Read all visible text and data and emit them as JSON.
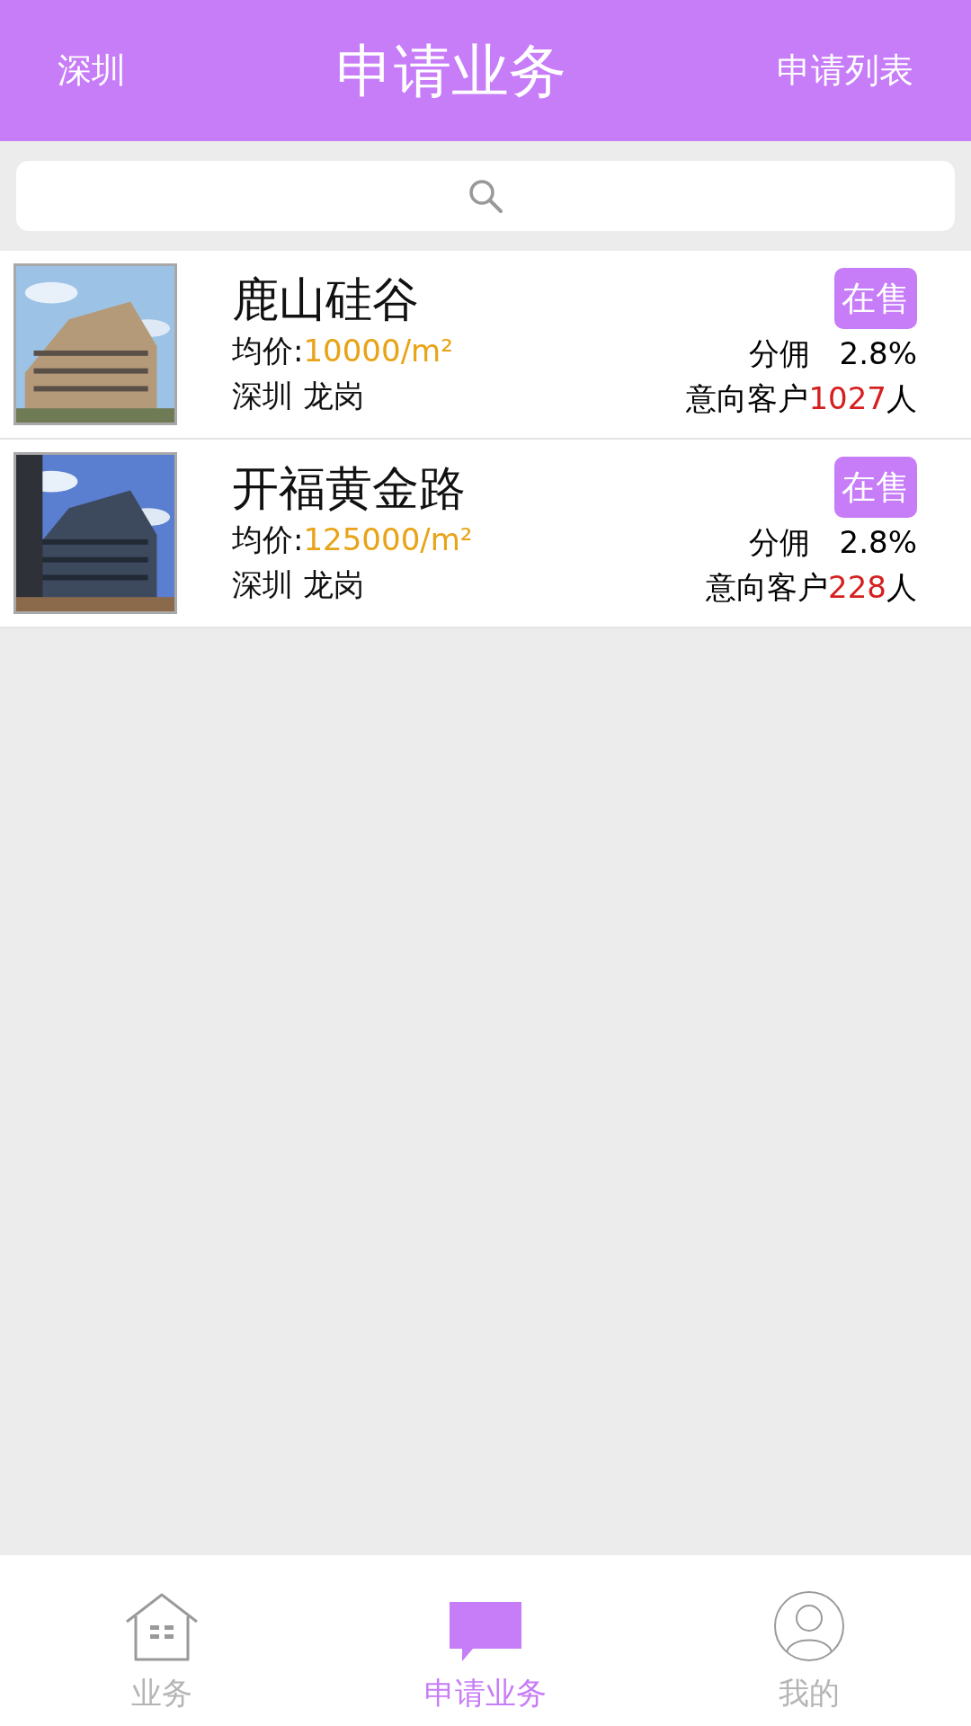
{
  "header": {
    "city": "深圳",
    "title": "申请业务",
    "action": "申请列表"
  },
  "listings": [
    {
      "name": "鹿山硅谷",
      "price_label": "均价:",
      "price": "10000/m²",
      "location": "深圳 龙岗",
      "status": "在售",
      "commission_label": "分佣",
      "commission": "2.8%",
      "clients_label": "意向客户",
      "clients": "1027",
      "clients_unit": "人"
    },
    {
      "name": "开福黄金路",
      "price_label": "均价:",
      "price": "125000/m²",
      "location": "深圳 龙岗",
      "status": "在售",
      "commission_label": "分佣",
      "commission": "2.8%",
      "clients_label": "意向客户",
      "clients": "228",
      "clients_unit": "人"
    }
  ],
  "tabs": [
    {
      "label": "业务",
      "kind": "home",
      "selected": false
    },
    {
      "label": "申请业务",
      "kind": "chat",
      "selected": true
    },
    {
      "label": "我的",
      "kind": "user",
      "selected": false
    }
  ]
}
